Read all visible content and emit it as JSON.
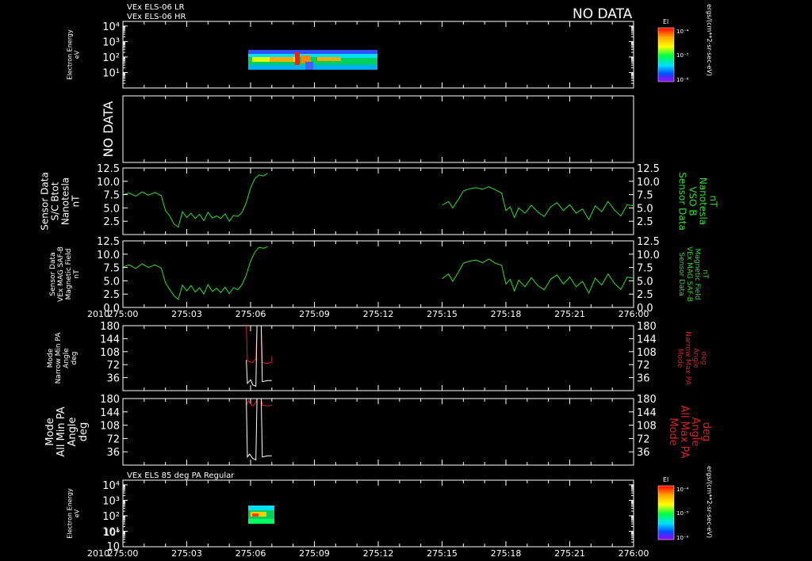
{
  "header": {
    "title_lines": [
      "VEx ELS-06 LR",
      "VEx ELS-06 HR"
    ],
    "no_data_label": "NO DATA",
    "panel7_title": "VEx ELS 85 deg PA Regular",
    "year_label": "2010"
  },
  "colors": {
    "background": "#000000",
    "axis": "#ffffff",
    "green": "#33dd33",
    "red": "#dd2222",
    "white": "#ffffff"
  },
  "colorbar": {
    "title": "El",
    "ticks": [
      "10⁻⁴",
      "10⁻⁵",
      "10⁻⁶"
    ],
    "unit_label": "ergs/(cm**2-sr-sec-eV)"
  },
  "chart_data": [
    {
      "id": "els-lr-hr",
      "type": "heatmap",
      "ylabel": [
        "Electron Energy",
        "eV"
      ],
      "yscale": "log",
      "ylim": [
        1,
        20000
      ],
      "yticks": [
        "10⁴",
        "10³",
        "10²",
        "10¹"
      ],
      "data_time_range": [
        "275:05",
        "275:12"
      ],
      "status": "NO DATA"
    },
    {
      "id": "no-data-panel",
      "type": "heatmap",
      "status": "NO DATA"
    },
    {
      "id": "sc-btot",
      "type": "line",
      "ylabel_left": [
        "Sensor Data",
        "S/C Btot",
        "Nanotesla",
        "nT"
      ],
      "ylabel_right": [
        "Sensor Data",
        "VSO B",
        "Nanotesla",
        "nT"
      ],
      "ylim": [
        0,
        12.5
      ],
      "yticks": [
        "12.5",
        "10.0",
        "7.5",
        "5.0",
        "2.5"
      ],
      "series": [
        {
          "color": "green",
          "segments": [
            [
              [
                0,
                7.5
              ],
              [
                0.3,
                7.8
              ],
              [
                0.6,
                7.2
              ],
              [
                0.9,
                8.0
              ],
              [
                1.2,
                7.4
              ],
              [
                1.5,
                7.9
              ],
              [
                1.8,
                7.3
              ],
              [
                2.0,
                4.5
              ],
              [
                2.2,
                3.5
              ],
              [
                2.4,
                2.0
              ],
              [
                2.6,
                1.4
              ],
              [
                2.8,
                4.3
              ],
              [
                3.0,
                3.2
              ],
              [
                3.2,
                4.0
              ],
              [
                3.4,
                3.0
              ],
              [
                3.6,
                3.8
              ],
              [
                3.8,
                2.6
              ],
              [
                4.0,
                4.2
              ],
              [
                4.2,
                3.1
              ],
              [
                4.4,
                3.5
              ],
              [
                4.6,
                3.0
              ],
              [
                4.8,
                3.9
              ],
              [
                5.0,
                2.5
              ],
              [
                5.2,
                3.6
              ],
              [
                5.4,
                3.4
              ],
              [
                5.6,
                4.2
              ],
              [
                5.8,
                6.0
              ],
              [
                6.0,
                8.8
              ],
              [
                6.2,
                10.5
              ],
              [
                6.4,
                11.2
              ],
              [
                6.6,
                11.0
              ],
              [
                6.8,
                11.5
              ]
            ],
            [
              [
                15.0,
                5.5
              ],
              [
                15.3,
                6.2
              ],
              [
                15.5,
                5.0
              ],
              [
                15.8,
                6.8
              ],
              [
                16.0,
                8.2
              ],
              [
                16.3,
                8.6
              ],
              [
                16.6,
                8.8
              ],
              [
                16.9,
                8.5
              ],
              [
                17.2,
                9.0
              ],
              [
                17.5,
                8.4
              ],
              [
                17.8,
                7.8
              ],
              [
                18.0,
                4.5
              ],
              [
                18.2,
                5.2
              ],
              [
                18.4,
                3.2
              ],
              [
                18.6,
                5.0
              ],
              [
                18.9,
                4.0
              ],
              [
                19.2,
                5.5
              ],
              [
                19.5,
                4.2
              ],
              [
                19.8,
                3.4
              ],
              [
                20.1,
                5.2
              ],
              [
                20.4,
                6.0
              ],
              [
                20.7,
                4.5
              ],
              [
                21.0,
                5.6
              ],
              [
                21.3,
                4.0
              ],
              [
                21.6,
                4.8
              ],
              [
                21.9,
                2.8
              ],
              [
                22.2,
                5.4
              ],
              [
                22.5,
                4.3
              ],
              [
                22.8,
                6.2
              ],
              [
                23.1,
                4.6
              ],
              [
                23.4,
                3.5
              ],
              [
                23.7,
                5.6
              ],
              [
                24.0,
                5.4
              ]
            ]
          ]
        }
      ]
    },
    {
      "id": "mag-saf-b",
      "type": "line",
      "ylabel_left": [
        "Sensor Data",
        "VEx MAG SAF-B",
        "Magnetic Field",
        "nT"
      ],
      "ylabel_right": [
        "Sensor Data",
        "VEx MAG SAF-B",
        "Magnetic Field",
        "nT"
      ],
      "ylim": [
        0,
        12.5
      ],
      "yticks": [
        "12.5",
        "10.0",
        "7.5",
        "5.0",
        "2.5",
        "0.0"
      ],
      "series": [
        {
          "color": "green",
          "segments": [
            [
              [
                0,
                7.6
              ],
              [
                0.3,
                8.0
              ],
              [
                0.6,
                7.3
              ],
              [
                0.9,
                8.2
              ],
              [
                1.2,
                7.5
              ],
              [
                1.5,
                8.0
              ],
              [
                1.8,
                7.4
              ],
              [
                2.0,
                4.6
              ],
              [
                2.2,
                3.4
              ],
              [
                2.4,
                2.2
              ],
              [
                2.6,
                1.5
              ],
              [
                2.8,
                4.2
              ],
              [
                3.0,
                3.1
              ],
              [
                3.2,
                4.1
              ],
              [
                3.4,
                2.9
              ],
              [
                3.6,
                3.7
              ],
              [
                3.8,
                2.5
              ],
              [
                4.0,
                4.3
              ],
              [
                4.2,
                3.0
              ],
              [
                4.4,
                3.6
              ],
              [
                4.6,
                2.8
              ],
              [
                4.8,
                3.8
              ],
              [
                5.0,
                2.6
              ],
              [
                5.2,
                3.7
              ],
              [
                5.4,
                3.3
              ],
              [
                5.6,
                4.3
              ],
              [
                5.8,
                6.1
              ],
              [
                6.0,
                8.7
              ],
              [
                6.2,
                10.4
              ],
              [
                6.4,
                11.3
              ],
              [
                6.6,
                11.1
              ],
              [
                6.8,
                11.4
              ]
            ],
            [
              [
                15.0,
                5.4
              ],
              [
                15.3,
                6.3
              ],
              [
                15.5,
                4.9
              ],
              [
                15.8,
                6.9
              ],
              [
                16.0,
                8.3
              ],
              [
                16.3,
                8.7
              ],
              [
                16.6,
                8.9
              ],
              [
                16.9,
                8.4
              ],
              [
                17.2,
                9.1
              ],
              [
                17.5,
                8.3
              ],
              [
                17.8,
                7.9
              ],
              [
                18.0,
                4.4
              ],
              [
                18.2,
                5.3
              ],
              [
                18.4,
                3.1
              ],
              [
                18.6,
                5.1
              ],
              [
                18.9,
                3.9
              ],
              [
                19.2,
                5.6
              ],
              [
                19.5,
                4.1
              ],
              [
                19.8,
                3.3
              ],
              [
                20.1,
                5.3
              ],
              [
                20.4,
                6.1
              ],
              [
                20.7,
                4.4
              ],
              [
                21.0,
                5.7
              ],
              [
                21.3,
                3.9
              ],
              [
                21.6,
                4.9
              ],
              [
                21.9,
                2.7
              ],
              [
                22.2,
                5.5
              ],
              [
                22.5,
                4.2
              ],
              [
                22.8,
                6.3
              ],
              [
                23.1,
                4.5
              ],
              [
                23.4,
                3.4
              ],
              [
                23.7,
                5.7
              ],
              [
                24.0,
                5.5
              ]
            ]
          ]
        }
      ]
    },
    {
      "id": "narrow-pa",
      "type": "line",
      "ylabel_left": [
        "Mode",
        "Narrow Min PA",
        "Angle",
        "deg"
      ],
      "ylabel_right": [
        "Mode",
        "Narrow Max PA",
        "Angle",
        "deg"
      ],
      "ylim": [
        0,
        180
      ],
      "yticks": [
        "180",
        "144",
        "108",
        "72",
        "36"
      ],
      "series": [
        {
          "color": "red",
          "segments": [
            [
              [
                5.8,
                180
              ],
              [
                5.85,
                82
              ],
              [
                6.1,
                78
              ],
              [
                6.25,
                88
              ],
              [
                6.3,
                180
              ],
              [
                6.5,
                180
              ],
              [
                6.55,
                78
              ],
              [
                6.8,
                75
              ],
              [
                7.0,
                80
              ],
              [
                7.0,
                95
              ]
            ]
          ]
        },
        {
          "color": "white",
          "segments": [
            [
              [
                5.8,
                85
              ],
              [
                5.85,
                20
              ],
              [
                6.0,
                30
              ],
              [
                6.1,
                16
              ],
              [
                6.25,
                12
              ],
              [
                6.3,
                180
              ],
              [
                6.5,
                180
              ],
              [
                6.55,
                25
              ],
              [
                6.8,
                28
              ],
              [
                7.0,
                28
              ]
            ]
          ]
        }
      ]
    },
    {
      "id": "all-pa",
      "type": "line",
      "ylabel_left": [
        "Mode",
        "All Min PA",
        "Angle",
        "deg"
      ],
      "ylabel_right": [
        "Mode",
        "All Max PA",
        "Angle",
        "deg"
      ],
      "ylim": [
        0,
        180
      ],
      "yticks": [
        "180",
        "144",
        "108",
        "72",
        "36"
      ],
      "series": [
        {
          "color": "red",
          "segments": [
            [
              [
                5.8,
                160
              ],
              [
                5.9,
                175
              ],
              [
                6.0,
                165
              ],
              [
                6.1,
                160
              ],
              [
                6.25,
                170
              ],
              [
                6.3,
                180
              ],
              [
                6.5,
                180
              ],
              [
                6.55,
                162
              ],
              [
                6.8,
                160
              ],
              [
                7.0,
                162
              ]
            ]
          ]
        },
        {
          "color": "white",
          "segments": [
            [
              [
                5.8,
                180
              ],
              [
                5.85,
                22
              ],
              [
                5.95,
                30
              ],
              [
                6.1,
                18
              ],
              [
                6.25,
                14
              ],
              [
                6.3,
                180
              ],
              [
                6.5,
                180
              ],
              [
                6.55,
                22
              ],
              [
                6.8,
                25
              ],
              [
                7.0,
                25
              ]
            ]
          ]
        }
      ]
    },
    {
      "id": "els-85pa",
      "type": "heatmap",
      "ylabel": [
        "Electron Energy",
        "eV"
      ],
      "yscale": "log",
      "ylim": [
        1,
        20000
      ],
      "yticks": [
        "10⁴",
        "10³",
        "10²",
        "10¹",
        "10⁰",
        "10"
      ],
      "data_time_range": [
        "275:05",
        "275:07"
      ]
    }
  ],
  "xaxis": {
    "ticks": [
      "275:00",
      "275:03",
      "275:06",
      "275:09",
      "275:12",
      "275:15",
      "275:18",
      "275:21",
      "276:00"
    ],
    "xlim": [
      0,
      24
    ]
  }
}
